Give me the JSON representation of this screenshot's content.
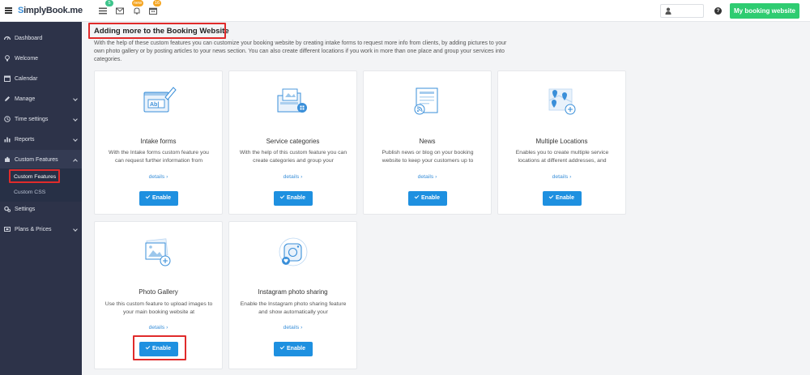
{
  "app": {
    "logo_prefix": "S",
    "logo_text": "implyBook.me"
  },
  "topbar": {
    "badges": [
      "5",
      "new",
      "16"
    ],
    "my_booking_label": "My booking website",
    "help_label": "?"
  },
  "sidebar": {
    "items": [
      {
        "label": "Dashboard",
        "icon": "dashboard-icon"
      },
      {
        "label": "Welcome",
        "icon": "bulb-icon"
      },
      {
        "label": "Calendar",
        "icon": "calendar-icon"
      },
      {
        "label": "Manage",
        "icon": "pencil-icon"
      },
      {
        "label": "Time settings",
        "icon": "clock-icon"
      },
      {
        "label": "Reports",
        "icon": "bar-chart-icon"
      },
      {
        "label": "Custom Features",
        "icon": "puzzle-icon"
      },
      {
        "label": "Settings",
        "icon": "gears-icon"
      },
      {
        "label": "Plans & Prices",
        "icon": "plans-icon"
      }
    ],
    "sub_items": [
      "Custom Features",
      "Custom CSS"
    ]
  },
  "main": {
    "title": "Adding more to the Booking Website",
    "intro": "With the help of these custom features you can customize your booking website by creating intake forms to request more info from clients, by adding pictures to your own photo gallery or by posting articles to your news section. You can also create different locations if you work in more than one place and group your services into categories.",
    "details_label": "details",
    "enable_label": "Enable",
    "cards": [
      {
        "title": "Intake forms",
        "desc": "With the Intake forms custom feature you can request further information from",
        "icon": "intake-forms-icon"
      },
      {
        "title": "Service categories",
        "desc": "With the help of this custom feature you can create categories and group your",
        "icon": "service-categories-icon"
      },
      {
        "title": "News",
        "desc": "Publish news or blog on your booking website to keep your customers up to",
        "icon": "news-icon"
      },
      {
        "title": "Multiple Locations",
        "desc": "Enables you to create multiple service locations at different addresses, and",
        "icon": "map-pin-icon"
      },
      {
        "title": "Photo Gallery",
        "desc": "Use this custom feature to upload images to your main booking website at",
        "icon": "photo-gallery-icon"
      },
      {
        "title": "Instagram photo sharing",
        "desc": "Enable the Instagram photo sharing feature and show automatically your",
        "icon": "instagram-icon"
      }
    ]
  },
  "colors": {
    "accent": "#1e90e0",
    "green": "#2ecc71",
    "sidebar": "#2d3349",
    "highlight": "#e02b2b"
  }
}
